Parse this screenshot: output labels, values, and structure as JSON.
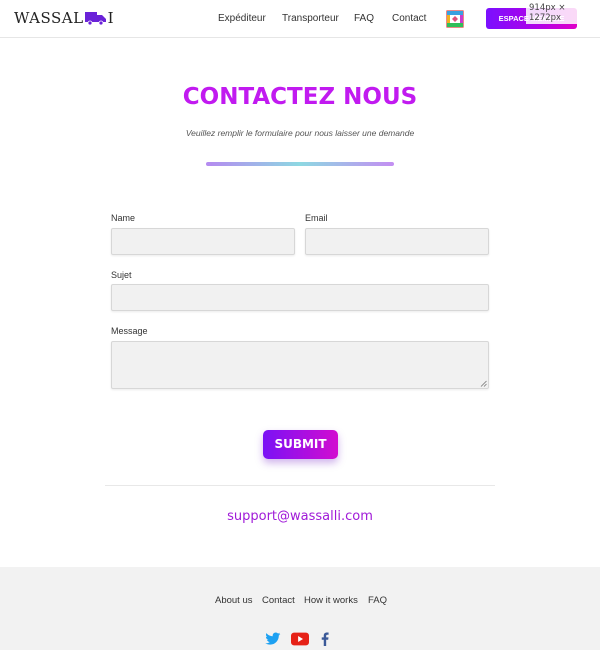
{
  "header": {
    "logo_text_left": "WASSAL",
    "logo_text_right": "I",
    "nav": [
      "Expéditeur",
      "Transporteur",
      "FAQ",
      "Contact"
    ],
    "member_button": "ESPACE MEMBRE",
    "dimension_badge": "914px × 1272px"
  },
  "hero": {
    "title": "CONTACTEZ NOUS",
    "subtitle": "Veuillez remplir le formulaire pour nous laisser une demande"
  },
  "form": {
    "name_label": "Name",
    "email_label": "Email",
    "subject_label": "Sujet",
    "message_label": "Message",
    "name_value": "",
    "email_value": "",
    "subject_value": "",
    "message_value": "",
    "submit_label": "SUBMIT"
  },
  "support_email": "support@wassalli.com",
  "footer": {
    "links": [
      "About us",
      "Contact",
      "How it works",
      "FAQ"
    ],
    "social": [
      "twitter-icon",
      "youtube-icon",
      "facebook-icon"
    ]
  },
  "colors": {
    "accent": "#c11af0",
    "button_gradient_start": "#7a12f5",
    "button_gradient_end": "#d20cd0",
    "footer_bg": "#f2f2f2"
  }
}
